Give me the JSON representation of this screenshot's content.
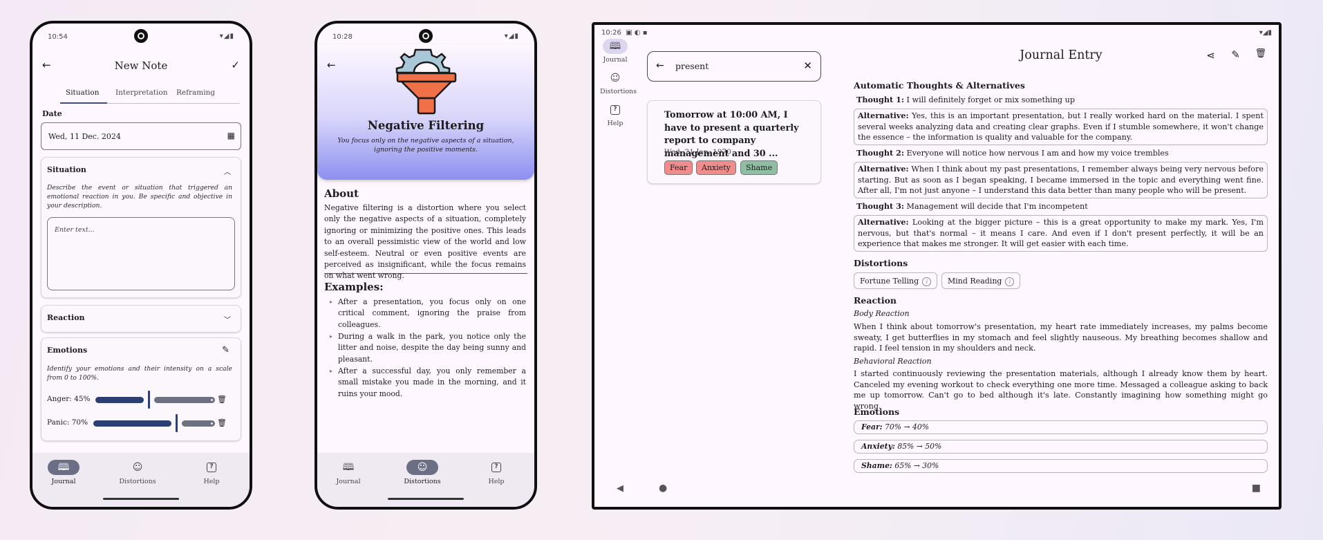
{
  "phone1": {
    "status_time": "10:54",
    "status_icons": "▾◢▮",
    "title": "New Note",
    "back_icon": "arrow-left-icon",
    "confirm_icon": "check-icon",
    "tabs": [
      "Situation",
      "Interpretation",
      "Reframing"
    ],
    "date_label": "Date",
    "date_value": "Wed, 11 Dec. 2024",
    "situation_title": "Situation",
    "situation_hint": "Describe the event or situation that triggered an emotional reaction in you. Be specific and objective in your description.",
    "situation_placeholder": "Enter text...",
    "reaction_title": "Reaction",
    "emotions_title": "Emotions",
    "emotions_hint": "Identify your emotions and their intensity on a scale from 0 to 100%.",
    "emotions": [
      {
        "label": "Anger: 45%",
        "value": 45
      },
      {
        "label": "Panic: 70%",
        "value": 70
      }
    ],
    "nav": [
      "Journal",
      "Distortions",
      "Help"
    ],
    "nav_active": 0
  },
  "phone2": {
    "status_time": "10:28",
    "status_icons": "▾◢▮",
    "title": "Negative Filtering",
    "subtitle": "You focus only on the negative aspects of a situation, ignoring the positive moments.",
    "about_heading": "About",
    "about_text": "Negative filtering is a distortion where you select only the negative aspects of a situation, completely ignoring or minimizing the positive ones. This leads to an overall pessimistic view of the world and low self-esteem. Neutral or even positive events are perceived as insignificant, while the focus remains on what went wrong.",
    "examples_heading": "Examples:",
    "examples": [
      "After a presentation, you focus only on one critical comment, ignoring the praise from colleagues.",
      "During a walk in the park, you notice only the litter and noise, despite the day being sunny and pleasant.",
      "After a successful day, you only remember a small mistake you made in the morning, and it ruins your mood."
    ],
    "nav": [
      "Journal",
      "Distortions",
      "Help"
    ],
    "nav_active": 1
  },
  "tablet": {
    "status_time": "10:26",
    "status_icons_left": "▣ ◐ ▪",
    "status_icons_right": "▾◢▮",
    "rail": [
      "Journal",
      "Distortions",
      "Help"
    ],
    "search_query": "present",
    "result": {
      "title": "Tomorrow at 10:00 AM, I have to present a quarterly report to company management and 30 ...",
      "date": "Wed, 21 Jan. 1970",
      "chips": [
        {
          "label": "Fear",
          "color": "#f08c8c"
        },
        {
          "label": "Anxiety",
          "color": "#f08c8c"
        },
        {
          "label": "Shame",
          "color": "#8fbfa3"
        }
      ]
    },
    "entry_title": "Journal Entry",
    "thoughts_heading": "Automatic Thoughts & Alternatives",
    "thoughts": [
      {
        "label": "Thought 1:",
        "text": " I will definitely forget or mix something up",
        "alt_label": "Alternative:",
        "alt": " Yes, this is an important presentation, but I really worked hard on the material. I spent several weeks analyzing data and creating clear graphs. Even if I stumble somewhere, it won't change the essence – the information is quality and valuable for the company."
      },
      {
        "label": "Thought 2:",
        "text": " Everyone will notice how nervous I am and how my voice trembles",
        "alt_label": "Alternative:",
        "alt": " When I think about my past presentations, I remember always being very nervous before starting. But as soon as I began speaking, I became immersed in the topic and everything went fine. After all, I'm not just anyone – I understand this data better than many people who will be present."
      },
      {
        "label": "Thought 3:",
        "text": " Management will decide that I'm incompetent",
        "alt_label": "Alternative:",
        "alt": " Looking at the bigger picture – this is a great opportunity to make my mark. Yes, I'm nervous, but that's normal – it means I care. And even if I don't present perfectly, it will be an experience that makes me stronger. It will get easier with each time."
      }
    ],
    "distortions_heading": "Distortions",
    "distortions": [
      "Fortune Telling",
      "Mind Reading"
    ],
    "reaction_heading": "Reaction",
    "body_reaction_label": "Body Reaction",
    "body_reaction": "When I think about tomorrow's presentation, my heart rate immediately increases, my palms become sweaty, I get butterflies in my stomach and feel slightly nauseous. My breathing becomes shallow and rapid. I feel tension in my shoulders and neck.",
    "behavioral_reaction_label": "Behavioral Reaction",
    "behavioral_reaction": "I started continuously reviewing the presentation materials, although I already know them by heart. Canceled my evening workout to check everything one more time. Messaged a colleague asking to back me up tomorrow. Can't go to bed although it's late. Constantly imagining how something might go wrong.",
    "emotions_heading": "Emotions",
    "emotions": [
      {
        "name": "Fear:",
        "change": " 70% → 40%"
      },
      {
        "name": "Anxiety:",
        "change": " 85% → 50%"
      },
      {
        "name": "Shame:",
        "change": " 65% → 30%"
      }
    ]
  }
}
